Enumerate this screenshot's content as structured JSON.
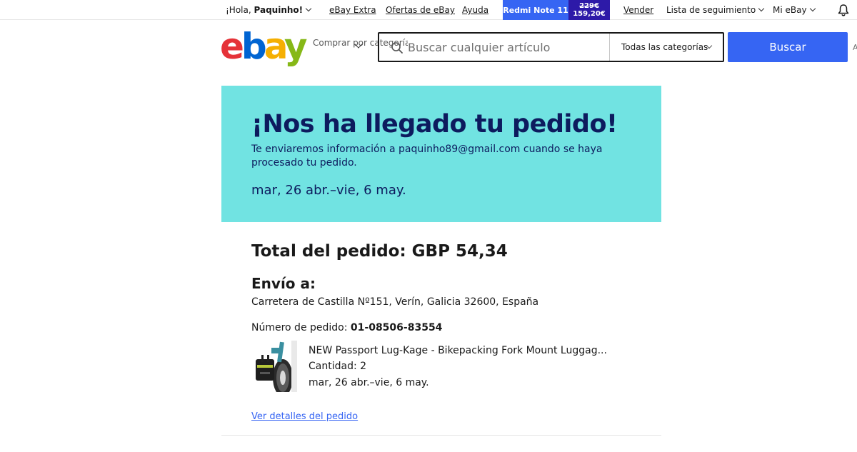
{
  "topbar": {
    "greeting_prefix": "¡Hola, ",
    "greeting_name": "Paquinho!",
    "links": [
      "eBay Extra",
      "Ofertas de eBay",
      "Ayuda"
    ],
    "promo": {
      "label": "Redmi Note 11",
      "old_price": "229€",
      "new_price": "159,20€"
    },
    "sell": "Vender",
    "watchlist": "Lista de seguimiento",
    "my_ebay": "Mi eBay",
    "bell_icon": "bell-icon"
  },
  "header": {
    "logo": "ebay",
    "shop_by_category": "Comprar por categoría",
    "search_placeholder": "Buscar cualquier artículo",
    "category_select": "Todas las categorías",
    "search_button": "Buscar"
  },
  "confirmation": {
    "title": "¡Nos ha llegado tu pedido!",
    "note": "Te enviaremos información a paquinho89@gmail.com cuando se haya procesado tu pedido.",
    "delivery_dates": "mar, 26 abr.–vie, 6 may."
  },
  "order": {
    "total": "Total del pedido: GBP 54,34",
    "ship_heading": "Envío a:",
    "address": "Carretera de Castilla Nº151, Verín, Galicia 32600, España",
    "order_number_label": "Número de pedido: ",
    "order_number": "01-08506-83554",
    "item": {
      "title": "NEW Passport Lug-Kage - Bikepacking Fork Mount Luggag...",
      "quantity": "Cantidad: 2",
      "dates": "mar, 26 abr.–vie, 6 may."
    },
    "details_link": "Ver detalles del pedido"
  },
  "colors": {
    "accent": "#3665f3",
    "hero_bg": "#71e3e2",
    "hero_text": "#0d1b5e",
    "promo_dark": "#2d1aa8"
  }
}
